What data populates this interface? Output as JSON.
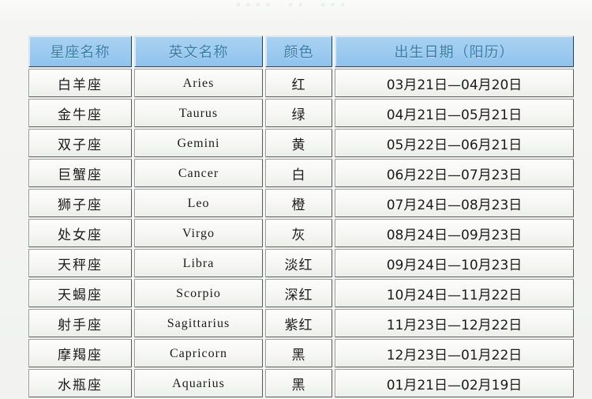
{
  "page": {
    "background_color": "#f2f3f1",
    "clipped_top_text": "。。。。  。。  。。。"
  },
  "table": {
    "header_bg_color": "#9ecbf0",
    "header_text_color": "#3b7fa8",
    "cell_bg_color": "#f6f7f4",
    "border_color": "#5a5a5a",
    "columns": [
      {
        "key": "name",
        "label": "星座名称"
      },
      {
        "key": "en",
        "label": "英文名称"
      },
      {
        "key": "color",
        "label": "颜色"
      },
      {
        "key": "date",
        "label": "出生日期（阳历）"
      }
    ],
    "rows": [
      {
        "name": "白羊座",
        "en": "Aries",
        "color": "红",
        "date": "03月21日—04月20日"
      },
      {
        "name": "金牛座",
        "en": "Taurus",
        "color": "绿",
        "date": "04月21日—05月21日"
      },
      {
        "name": "双子座",
        "en": "Gemini",
        "color": "黄",
        "date": "05月22日—06月21日"
      },
      {
        "name": "巨蟹座",
        "en": "Cancer",
        "color": "白",
        "date": "06月22日—07月23日"
      },
      {
        "name": "狮子座",
        "en": "Leo",
        "color": "橙",
        "date": "07月24日—08月23日"
      },
      {
        "name": "处女座",
        "en": "Virgo",
        "color": "灰",
        "date": "08月24日—09月23日"
      },
      {
        "name": "天秤座",
        "en": "Libra",
        "color": "淡红",
        "date": "09月24日—10月23日"
      },
      {
        "name": "天蝎座",
        "en": "Scorpio",
        "color": "深红",
        "date": "10月24日—11月22日"
      },
      {
        "name": "射手座",
        "en": "Sagittarius",
        "color": "紫红",
        "date": "11月23日—12月22日"
      },
      {
        "name": "摩羯座",
        "en": "Capricorn",
        "color": "黑",
        "date": "12月23日—01月22日"
      },
      {
        "name": "水瓶座",
        "en": "Aquarius",
        "color": "黑",
        "date": "01月21日—02月19日"
      }
    ]
  }
}
